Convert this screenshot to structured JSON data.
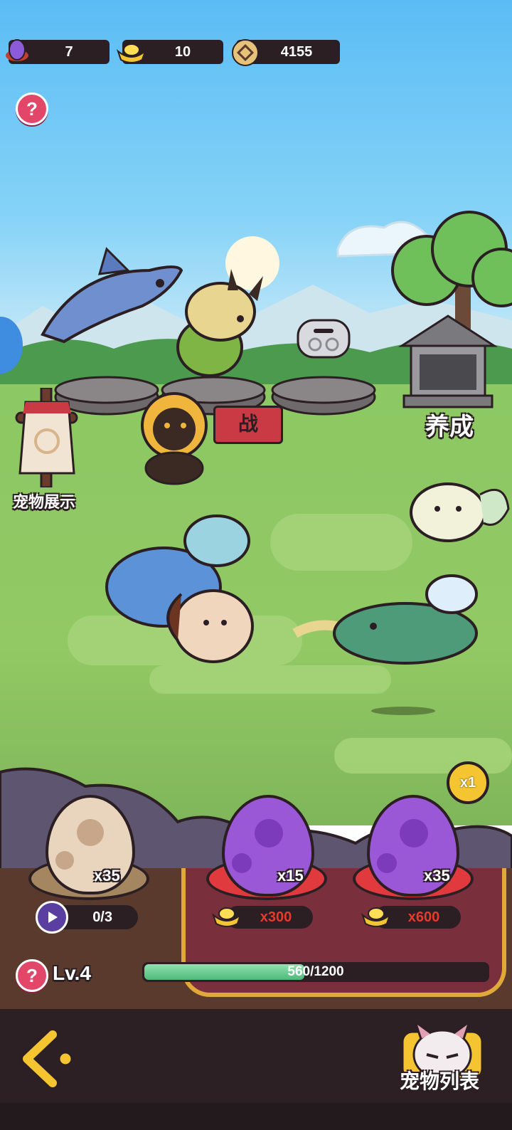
{
  "currencies": [
    {
      "icon": "purple-egg-icon",
      "value": "7"
    },
    {
      "icon": "gold-ingot-icon",
      "value": "10"
    },
    {
      "icon": "coin-icon",
      "value": "4155"
    }
  ],
  "scene": {
    "battle_sign_label": "战",
    "nurture_label": "养成",
    "pet_display_label": "宠物展示"
  },
  "speed_badge": "x1",
  "eggs": [
    {
      "type": "common-egg",
      "count": "x35",
      "video_progress": "0/3"
    },
    {
      "type": "purple-egg",
      "count": "x15",
      "price": "x300"
    },
    {
      "type": "purple-egg",
      "count": "x35",
      "price": "x600"
    }
  ],
  "level": {
    "label": "Lv.4",
    "xp_text": "560/1200",
    "xp_fraction": 0.4667
  },
  "bottom_nav": {
    "pet_list_label": "宠物列表",
    "back_icon": "chevron-left-icon"
  },
  "colors": {
    "accent_pink": "#e2476a",
    "price_red": "#e53b2e",
    "xp_green": "#4fb879",
    "gold": "#f4c531"
  }
}
